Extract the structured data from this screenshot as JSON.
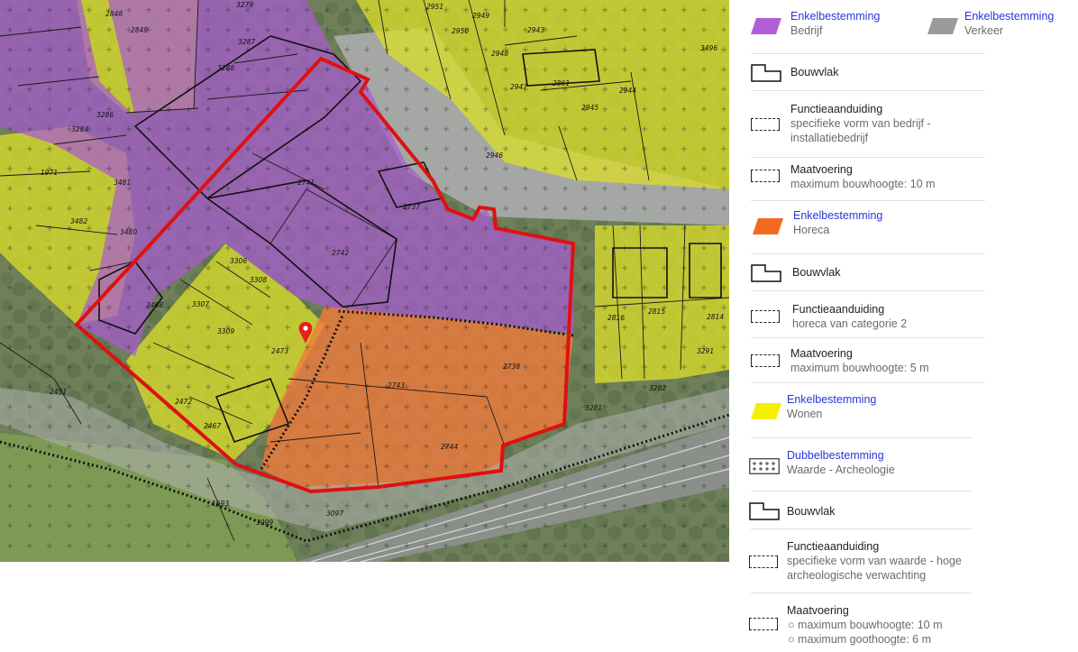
{
  "map": {
    "parcel_numbers": [
      "3279",
      "2848",
      "2849",
      "3287",
      "3288",
      "3286",
      "3284",
      "1971",
      "3481",
      "3482",
      "3480",
      "2741",
      "2737",
      "2742",
      "3306",
      "3308",
      "3307",
      "3309",
      "2468",
      "2473",
      "2472",
      "2467",
      "2451",
      "2743",
      "2738",
      "2744",
      "2816",
      "2815",
      "2814",
      "3291",
      "3282",
      "3281",
      "1693",
      "3099",
      "3097",
      "2951",
      "2949",
      "2950",
      "2943",
      "2948",
      "2947",
      "2861",
      "2944",
      "2945",
      "2946",
      "3496"
    ]
  },
  "legend": {
    "bedrijf": {
      "title": "Enkelbestemming",
      "sub": "Bedrijf",
      "color": "#b05fd6"
    },
    "verkeer": {
      "title": "Enkelbestemming",
      "sub": "Verkeer",
      "color": "#9b9b9b"
    },
    "bouwvlak_1": "Bouwvlak",
    "functie_1": {
      "title": "Functieaanduiding",
      "lines": [
        "specifieke vorm van bedrijf -",
        "installatiebedrijf"
      ]
    },
    "maat_1": {
      "title": "Maatvoering",
      "sub": "maximum bouwhoogte: 10 m"
    },
    "horeca": {
      "title": "Enkelbestemming",
      "sub": "Horeca",
      "color": "#f26a22"
    },
    "bouwvlak_2": "Bouwvlak",
    "functie_2": {
      "title": "Functieaanduiding",
      "sub": "horeca van categorie 2"
    },
    "maat_2": {
      "title": "Maatvoering",
      "sub": "maximum bouwhoogte: 5 m"
    },
    "wonen": {
      "title": "Enkelbestemming",
      "sub": "Wonen",
      "color": "#f5f000"
    },
    "archeologie": {
      "title": "Dubbelbestemming",
      "sub": "Waarde - Archeologie"
    },
    "bouwvlak_3": "Bouwvlak",
    "functie_3": {
      "title": "Functieaanduiding",
      "lines": [
        "specifieke vorm van waarde - hoge",
        "archeologische verwachting"
      ]
    },
    "maat_3": {
      "title": "Maatvoering",
      "items": [
        "maximum bouwhoogte: 10 m",
        "maximum goothoogte: 6 m"
      ]
    }
  }
}
